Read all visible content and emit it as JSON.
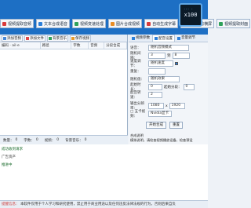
{
  "app": {
    "logo_text": "x100",
    "logo_dots": "··· ·"
  },
  "top_toolbar": [
    {
      "icon": "video-search-icon",
      "label": "视频提取音频"
    },
    {
      "icon": "text-merge-icon",
      "label": "文本合成语音"
    },
    {
      "icon": "split-video-icon",
      "label": "视频变速处理"
    },
    {
      "icon": "image-merge-icon",
      "label": "图片合成视频"
    },
    {
      "icon": "subtitle-icon",
      "label": "自动生成字幕"
    },
    {
      "icon": "crop-icon",
      "label": "画面裁剪横屏"
    },
    {
      "icon": "extract-icon",
      "label": "视频提取封面"
    }
  ],
  "left_toolbar": [
    {
      "label": "添加音频"
    },
    {
      "label": "添加文件"
    },
    {
      "label": "背景音乐"
    },
    {
      "label": "保存视频"
    }
  ],
  "table": {
    "columns": [
      "编码 · ail·e",
      "路径",
      "字数",
      "音频",
      "分段合成"
    ]
  },
  "stats": {
    "items_label": "数量：",
    "items_value": "0",
    "words_label": "字数：",
    "words_value": "0",
    "seg_label": "视频：",
    "seg_value": "0",
    "bgm_label": "背景音乐：",
    "bgm_value": "0"
  },
  "right_tabs": [
    {
      "label": "视频参数",
      "active": false
    },
    {
      "label": "配音设置",
      "active": true
    },
    {
      "label": "音量调节",
      "active": false
    }
  ],
  "fields": {
    "voice_label": "语音：",
    "voice_value": "随机音频模式",
    "interval_label": "随机间隔：",
    "interval_from": "3",
    "interval_to": "8",
    "speed_label": "速度调节：",
    "speed_value": "随机速度",
    "pitch_label": "重复：",
    "pitch_value": "",
    "retry_label": "随机值：",
    "retry_value": "随机效果",
    "start_label": "起始时长：",
    "start_value": "0",
    "end_label": "起始分段：",
    "end_value": "0",
    "shift_label": "配音转速：",
    "shift_value": "2",
    "resolution_label": "输出分辨率：",
    "res_w": "1080",
    "res_h": "1920",
    "format_label": "□ 五卡视频：",
    "format_value": "Nvidia显卡",
    "start_button": "开始合成",
    "reset_button": "重置",
    "desc_hint": "合成说明",
    "desc_hint2": "模拟说明，请检查视频播放设备，检查预设"
  },
  "log": {
    "line1": "成功收到请求",
    "line2": "广告资产",
    "line3": "推进中"
  },
  "marquee": {
    "warn": "提醒信息：",
    "text": "本软件仅用于个人学习和研究使用，禁止用于商业用途以及任何违反法律法规的行为，否则后果自负"
  }
}
